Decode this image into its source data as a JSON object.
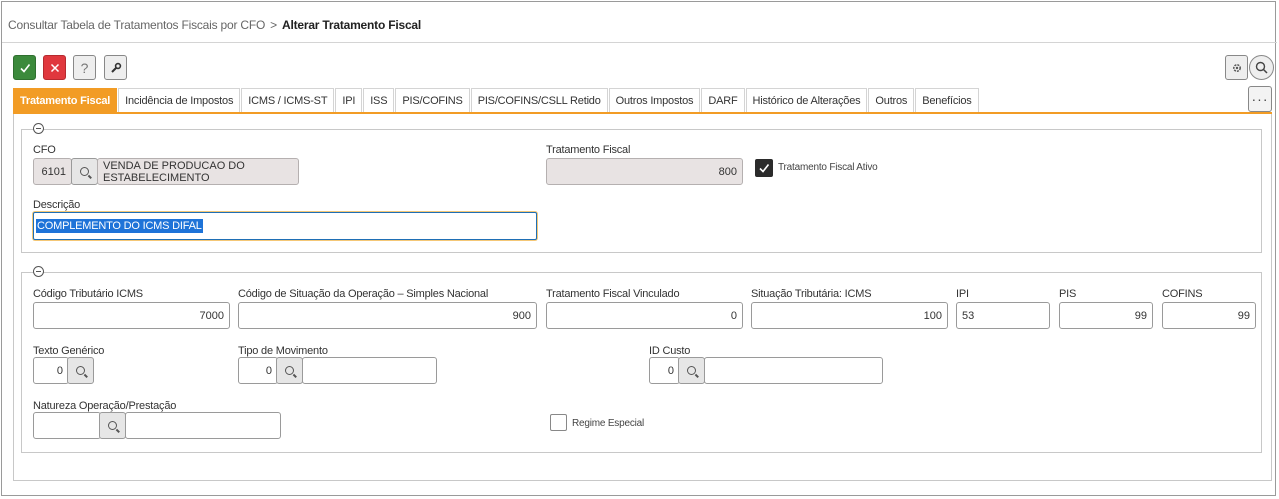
{
  "breadcrumb": {
    "parent": "Consultar Tabela de Tratamentos Fiscais por CFO",
    "separator": ">",
    "current": "Alterar Tratamento Fiscal"
  },
  "toolbar": {
    "confirm_icon": "check-icon",
    "cancel_icon": "close-icon",
    "help_label": "?",
    "tools_icon": "wrench-icon",
    "settings_icon": "gear-icon",
    "search_icon": "search-icon",
    "more_label": "···",
    "colors": {
      "confirm": "#3c8a3c",
      "cancel": "#e0383e",
      "tab_active": "#f29c25"
    }
  },
  "tabs": [
    {
      "label": "Tratamento Fiscal",
      "active": true
    },
    {
      "label": "Incidência de Impostos"
    },
    {
      "label": "ICMS / ICMS-ST"
    },
    {
      "label": "IPI"
    },
    {
      "label": "ISS"
    },
    {
      "label": "PIS/COFINS"
    },
    {
      "label": "PIS/COFINS/CSLL Retido"
    },
    {
      "label": "Outros Impostos"
    },
    {
      "label": "DARF"
    },
    {
      "label": "Histórico de Alterações"
    },
    {
      "label": "Outros"
    },
    {
      "label": "Benefícios"
    }
  ],
  "section1": {
    "cfo_label": "CFO",
    "cfo_code": "6101",
    "cfo_description": "VENDA DE PRODUCAO DO ESTABELECIMENTO",
    "tratamento_label": "Tratamento Fiscal",
    "tratamento_value": "800",
    "ativo_label": "Tratamento Fiscal Ativo",
    "ativo_checked": true,
    "descricao_label": "Descrição",
    "descricao_value": "COMPLEMENTO DO ICMS DIFAL"
  },
  "section2": {
    "codigo_trib_label": "Código Tributário ICMS",
    "codigo_trib_value": "7000",
    "csosn_label": "Código de Situação da Operação – Simples Nacional",
    "csosn_value": "900",
    "vinculado_label": "Tratamento Fiscal Vinculado",
    "vinculado_value": "0",
    "sit_icms_label": "Situação Tributária: ICMS",
    "sit_icms_value": "100",
    "ipi_label": "IPI",
    "ipi_value": "53",
    "pis_label": "PIS",
    "pis_value": "99",
    "cofins_label": "COFINS",
    "cofins_value": "99",
    "texto_label": "Texto Genérico",
    "texto_value": "0",
    "tipo_mov_label": "Tipo de Movimento",
    "tipo_mov_value": "0",
    "id_custo_label": "ID Custo",
    "id_custo_value": "0",
    "natureza_label": "Natureza Operação/Prestação",
    "natureza_value": "",
    "regime_label": "Regime Especial",
    "regime_checked": false
  }
}
